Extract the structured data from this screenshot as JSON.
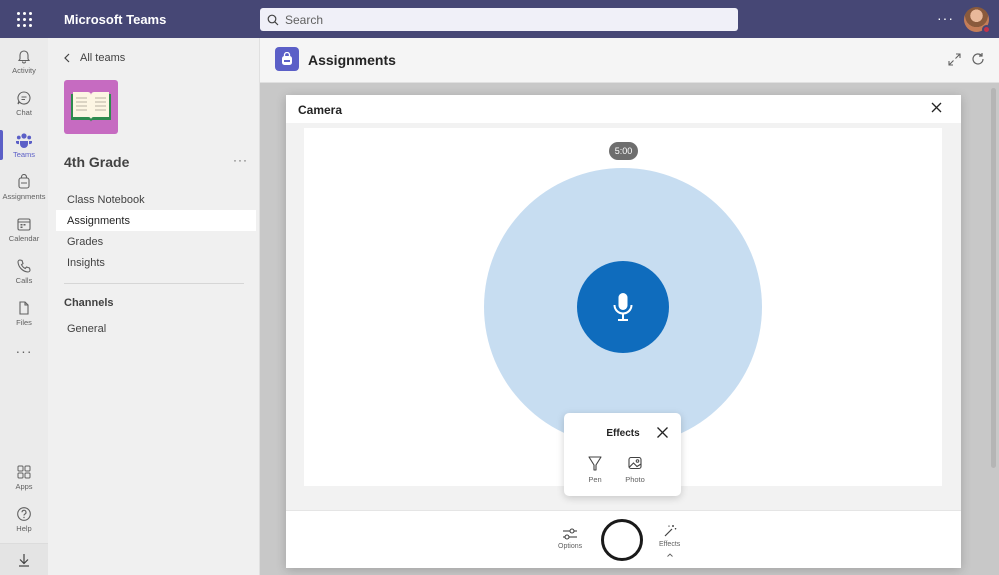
{
  "topbar": {
    "app_title": "Microsoft Teams",
    "search_placeholder": "Search",
    "more": "···"
  },
  "rail": {
    "items": [
      {
        "label": "Activity",
        "icon": "bell-icon"
      },
      {
        "label": "Chat",
        "icon": "chat-icon"
      },
      {
        "label": "Teams",
        "icon": "teams-icon"
      },
      {
        "label": "Assignments",
        "icon": "assignments-icon"
      },
      {
        "label": "Calendar",
        "icon": "calendar-icon"
      },
      {
        "label": "Calls",
        "icon": "phone-icon"
      },
      {
        "label": "Files",
        "icon": "file-icon"
      }
    ],
    "more": "···",
    "bottom_items": [
      {
        "label": "Apps",
        "icon": "apps-icon"
      },
      {
        "label": "Help",
        "icon": "help-icon"
      }
    ]
  },
  "panel": {
    "back_label": "All teams",
    "team_name": "4th Grade",
    "team_more": "···",
    "nav": [
      "Class Notebook",
      "Assignments",
      "Grades",
      "Insights"
    ],
    "active_nav": "Assignments",
    "channels_heading": "Channels",
    "channels": [
      "General"
    ]
  },
  "main": {
    "title": "Assignments"
  },
  "dialog": {
    "title": "Camera",
    "timer": "5:00",
    "effects": {
      "title": "Effects",
      "options": [
        {
          "label": "Pen",
          "icon": "pen-icon"
        },
        {
          "label": "Photo",
          "icon": "photo-icon"
        }
      ]
    },
    "bottom": {
      "options_label": "Options",
      "effects_label": "Effects"
    }
  },
  "colors": {
    "topbar": "#464775",
    "accent": "#5b5fc7",
    "mic_button": "#0f6cbd",
    "halo": "#c7ddf1"
  }
}
